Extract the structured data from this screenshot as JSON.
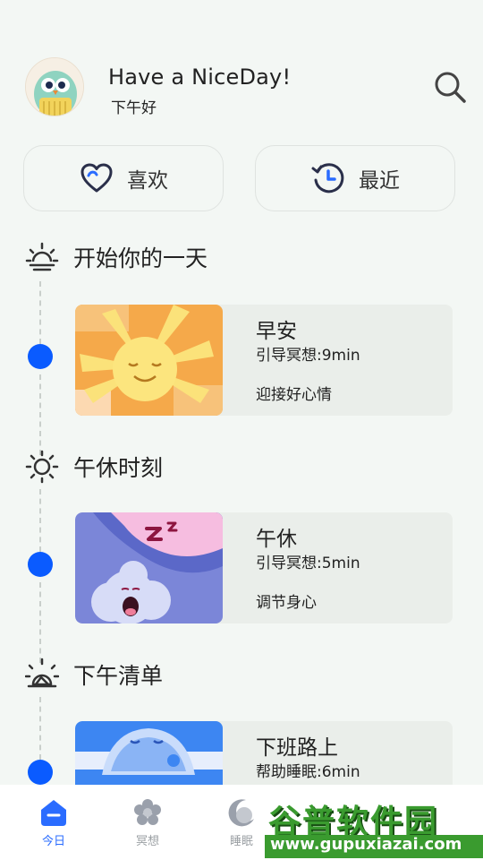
{
  "header": {
    "greeting": "Have a NiceDay!",
    "subtitle": "下午好"
  },
  "quick_actions": {
    "like_label": "喜欢",
    "recent_label": "最近"
  },
  "sections": [
    {
      "title": "开始你的一天",
      "icon": "sunrise-icon",
      "card": {
        "title": "早安",
        "meta": "引导冥想:9min",
        "desc": "迎接好心情"
      }
    },
    {
      "title": "午休时刻",
      "icon": "sun-icon",
      "card": {
        "title": "午休",
        "meta": "引导冥想:5min",
        "desc": "调节身心"
      }
    },
    {
      "title": "下午清单",
      "icon": "sunset-icon",
      "card": {
        "title": "下班路上",
        "meta": "帮助睡眠:6min",
        "desc": ""
      }
    }
  ],
  "tabs": [
    {
      "label": "今日",
      "icon": "home-icon",
      "active": true
    },
    {
      "label": "冥想",
      "icon": "flower-icon",
      "active": false
    },
    {
      "label": "睡眠",
      "icon": "moon-icon",
      "active": false
    }
  ],
  "watermark": {
    "brand": "谷普软件园",
    "url": "www.gupuxiazai.com"
  },
  "colors": {
    "accent": "#0a5bff",
    "background": "#f3f7f4",
    "card": "#eaeeea"
  }
}
